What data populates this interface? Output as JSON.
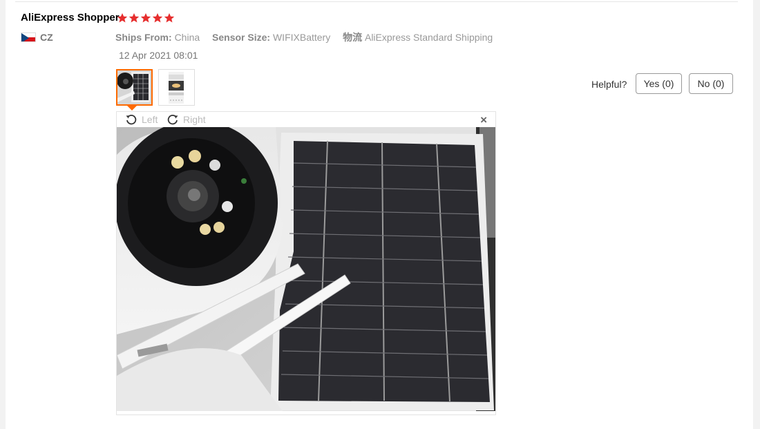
{
  "review": {
    "author": "AliExpress Shopper",
    "rating": 5,
    "country": "CZ",
    "ships_from_label": "Ships From:",
    "ships_from_value": "China",
    "sensor_label": "Sensor Size:",
    "sensor_value": "WIFIXBattery",
    "logistics_label": "物流",
    "logistics_value": "AliExpress Standard Shipping",
    "date": "12 Apr 2021 08:01"
  },
  "helpful": {
    "label": "Helpful?",
    "yes": "Yes (0)",
    "no": "No (0)"
  },
  "viewer": {
    "rotate_left": "Left",
    "rotate_right": "Right",
    "close": "×"
  },
  "colors": {
    "star": "#e62e2e",
    "accent": "#ff6a00"
  }
}
